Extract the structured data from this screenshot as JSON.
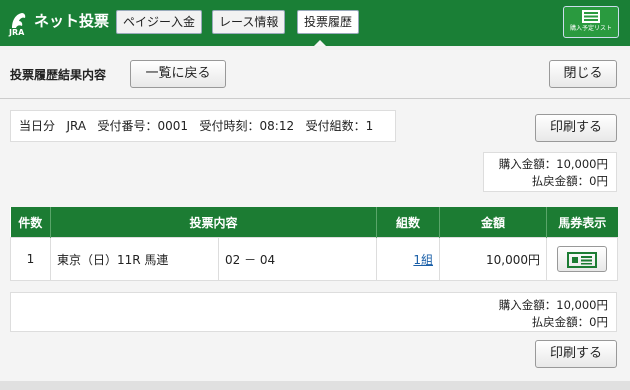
{
  "header": {
    "logo_text": "JRA",
    "app_title": "ネット投票",
    "nav": [
      {
        "label": "ペイジー入金"
      },
      {
        "label": "レース情報"
      },
      {
        "label": "投票履歴"
      }
    ],
    "cart_label": "購入予定リスト"
  },
  "panel": {
    "title": "投票履歴結果内容",
    "back_label": "一覧に戻る",
    "close_label": "閉じる",
    "print_label": "印刷する",
    "info": {
      "day": "当日分",
      "org": "JRA",
      "receipt_no": "受付番号：0001",
      "receipt_time": "受付時刻：08:12",
      "receipt_sets": "受付組数：1"
    },
    "summary": {
      "purchase": "購入金額：10,000円",
      "refund": "払戻金額：0円"
    },
    "table": {
      "headers": [
        "件数",
        "投票内容",
        "組数",
        "金額",
        "馬券表示"
      ],
      "rows": [
        {
          "no": "1",
          "race": "東京（日）11R 馬連",
          "combo": "02 － 04",
          "sets": "1組",
          "amount": "10,000円"
        }
      ]
    },
    "footer": {
      "purchase": "購入金額：10,000円",
      "refund": "払戻金額：0円"
    }
  }
}
